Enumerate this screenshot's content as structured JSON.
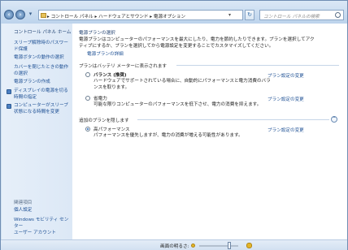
{
  "address_bar": {
    "crumbs": [
      "コントロール パネル",
      "ハードウェアとサウンド",
      "電源オプション"
    ]
  },
  "search": {
    "placeholder": "コントロール パネルの検索"
  },
  "sidebar": {
    "home": "コントロール パネル ホーム",
    "links": [
      "スリープ解除時のパスワード保護",
      "電源ボタンの動作の選択",
      "カバーを閉じたときの動作の選択",
      "電源プランの作成",
      "ディスプレイの電源を切る時間の指定",
      "コンピューターがスリープ状態になる時間を変更"
    ],
    "see_also": "関連項目",
    "see_also_links": [
      "個人設定",
      "Windows モビリティ センター",
      "ユーザー アカウント"
    ]
  },
  "main": {
    "heading": "電源プランの選択",
    "intro": "電源プランはコンピューターのパフォーマンスを最大にしたり、電力を節約したりできます。プランを選択してアクティブにするか、プランを選択してから電源設定を変更することでカスタマイズしてください。",
    "intro_link": "電源プランの詳細",
    "group1_title": "プランはバッテリ メーターに表示されます",
    "plans": [
      {
        "name": "バランス (推奨)",
        "desc": "ハードウェアでサポートされている場合に、自動的にパフォーマンスと電力消費のバランスを取ります。",
        "link": "プラン設定の変更",
        "selected": false
      },
      {
        "name": "省電力",
        "desc": "可能な限りコンピューターのパフォーマンスを低下させ、電力の消費を抑えます。",
        "link": "プラン設定の変更",
        "selected": false
      }
    ],
    "group2_title": "追加のプランを隠します",
    "extra_plan": {
      "name": "高パフォーマンス",
      "desc": "パフォーマンスを優先しますが、電力の消費が増える可能性があります。",
      "link": "プラン設定の変更",
      "selected": true
    }
  },
  "status_bar": {
    "brightness_label": "画面の明るさ:",
    "brightness_level": 0.8
  },
  "colors": {
    "link": "#1b4e93",
    "sidebar_bg": "#e6eff9",
    "chrome": "#bcd3ec"
  }
}
